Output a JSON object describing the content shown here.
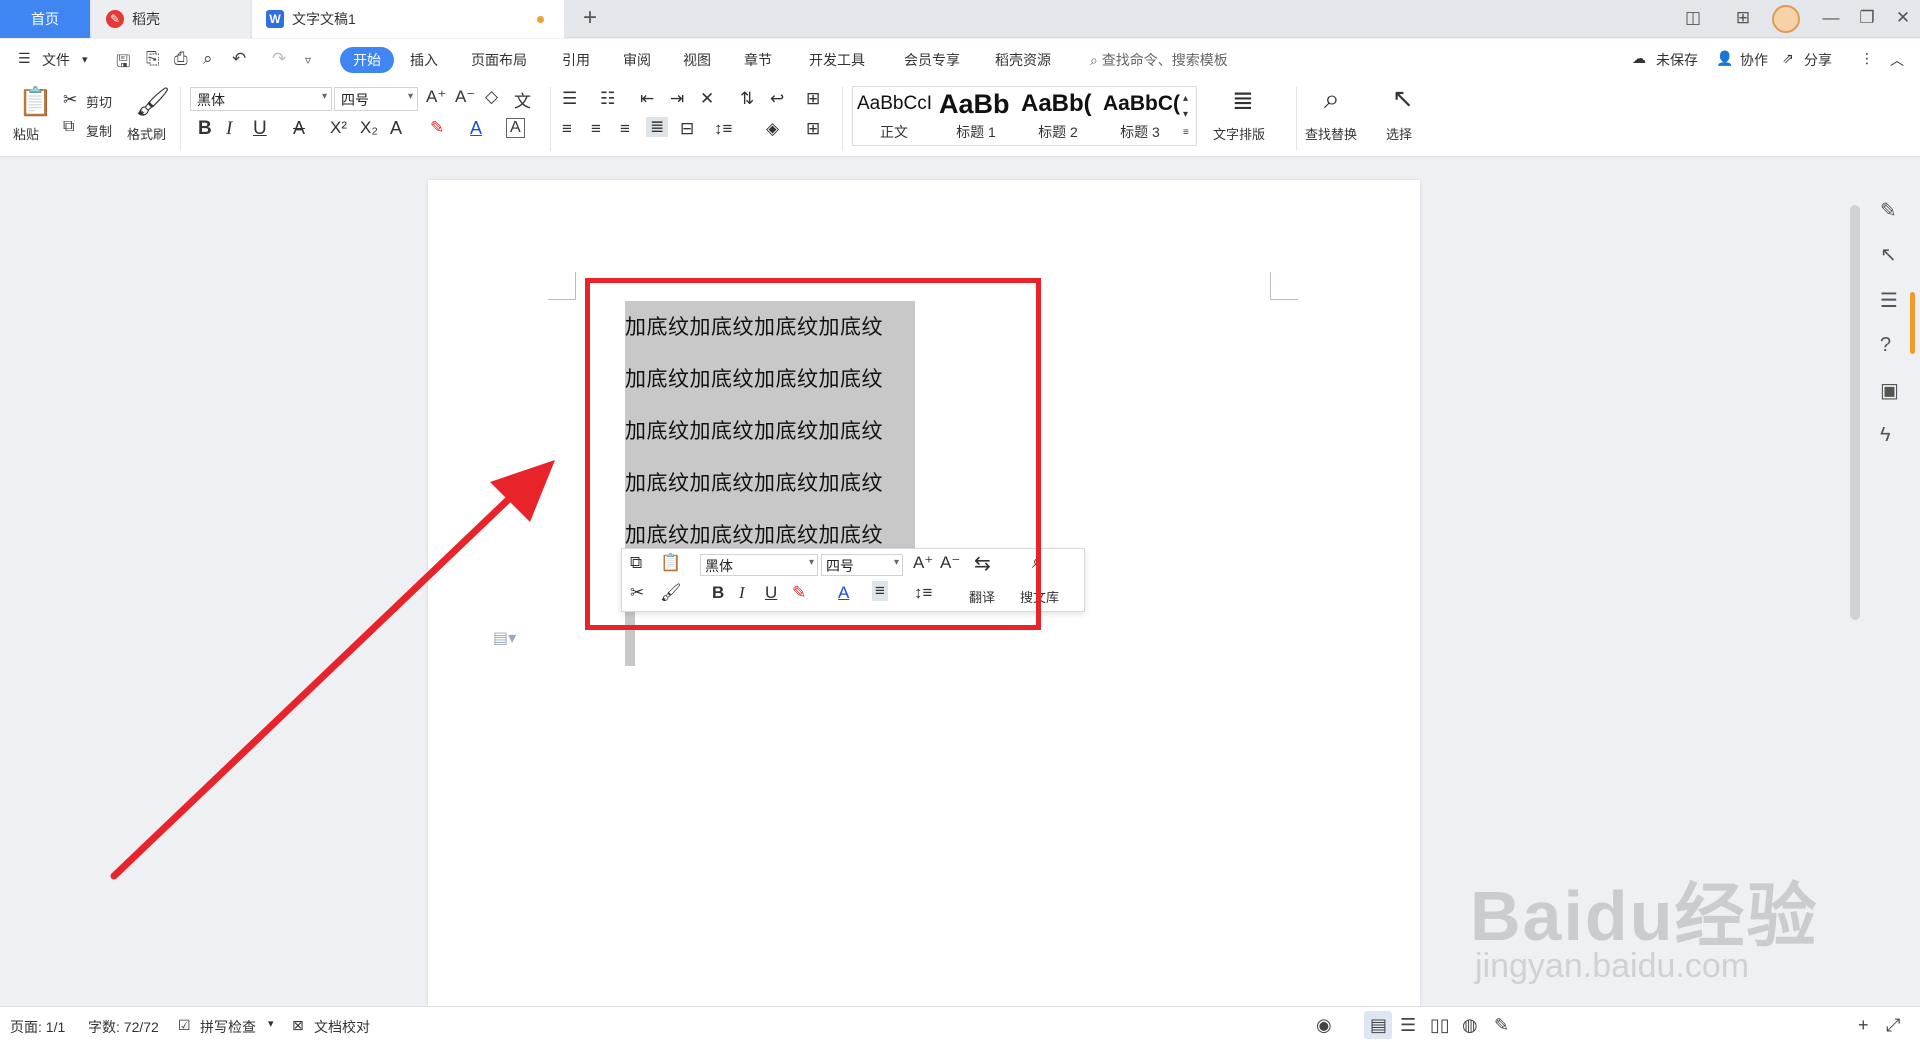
{
  "tabs": {
    "home": "首页",
    "daoke": "稻壳",
    "doc": "文字文稿1",
    "new": "+"
  },
  "menu": {
    "file": "文件",
    "items": [
      "开始",
      "插入",
      "页面布局",
      "引用",
      "审阅",
      "视图",
      "章节",
      "开发工具",
      "会员专享",
      "稻壳资源"
    ],
    "search": "查找命令、搜索模板",
    "unsaved": "未保存",
    "collab": "协作",
    "share": "分享"
  },
  "ribbon": {
    "paste": "粘贴",
    "cut": "剪切",
    "copy": "复制",
    "format_painter": "格式刷",
    "font": "黑体",
    "size": "四号",
    "styles": [
      {
        "preview": "AaBbCcI",
        "name": "正文"
      },
      {
        "preview": "AaBb",
        "name": "标题 1"
      },
      {
        "preview": "AaBb(",
        "name": "标题 2"
      },
      {
        "preview": "AaBbC(",
        "name": "标题 3"
      }
    ],
    "text_layout": "文字排版",
    "find_replace": "查找替换",
    "select": "选择"
  },
  "document": {
    "lines": [
      "加底纹加底纹加底纹加底纹",
      "加底纹加底纹加底纹加底纹",
      "加底纹加底纹加底纹加底纹",
      "加底纹加底纹加底纹加底纹",
      "加底纹加底纹加底纹加底纹"
    ]
  },
  "float_toolbar": {
    "font": "黑体",
    "size": "四号",
    "translate": "翻译",
    "search_lib": "搜文库"
  },
  "status": {
    "page": "页面: 1/1",
    "words": "字数: 72/72",
    "spell": "拼写检查",
    "proof": "文档校对"
  },
  "watermark": {
    "text": "Baidu经验",
    "url": "jingyan.baidu.com"
  },
  "colors": {
    "accent": "#3f86f2",
    "highlight_box": "#e8232a",
    "selection": "#c8c8c8"
  }
}
